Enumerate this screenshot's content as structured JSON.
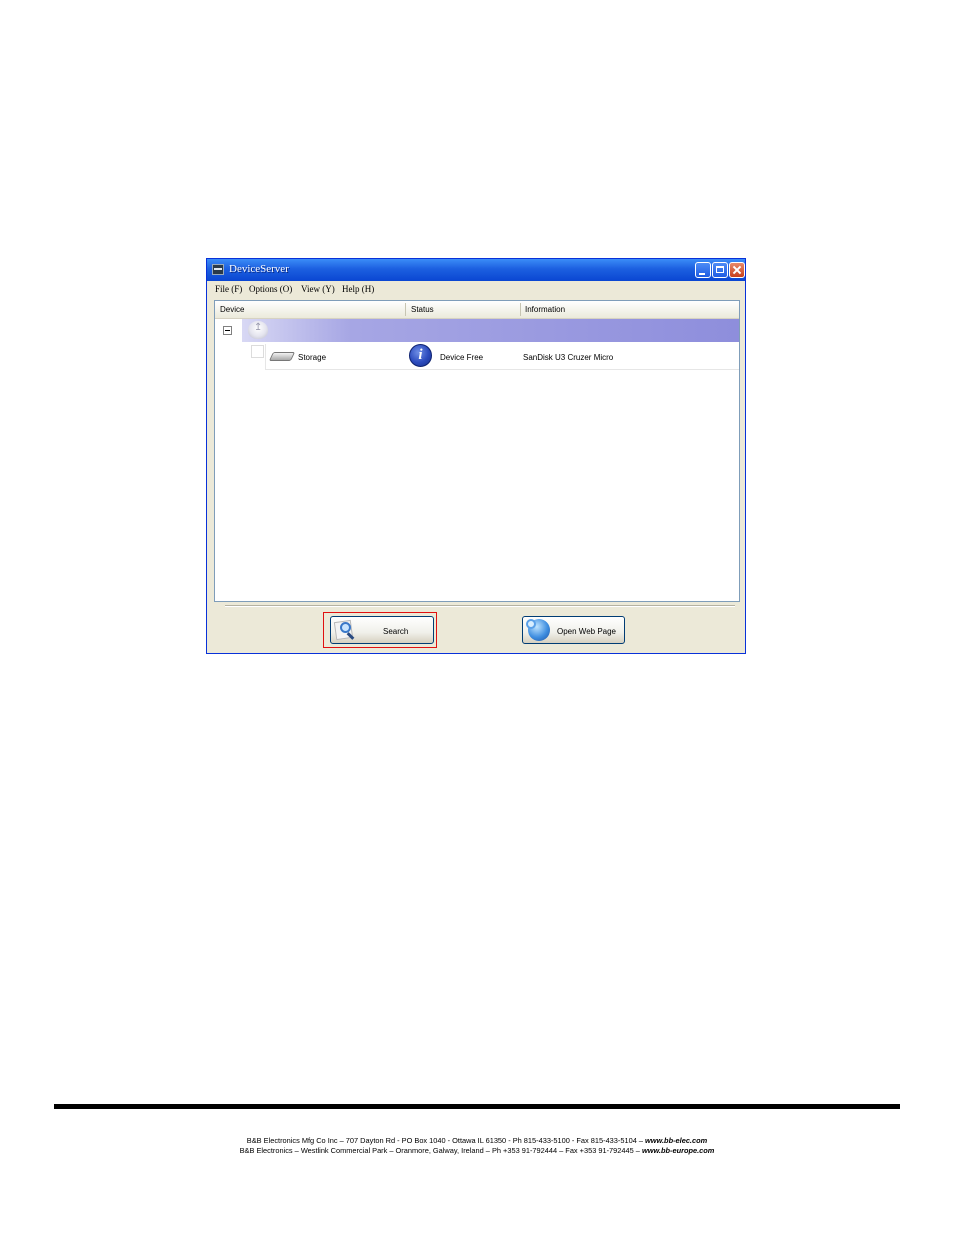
{
  "window": {
    "title": "DeviceServer",
    "menu": [
      "File (F)",
      "Options (O)",
      "View (Y)",
      "Help (H)"
    ]
  },
  "list": {
    "columns": [
      "Device",
      "Status",
      "Information"
    ],
    "rows": [
      {
        "device": "Storage",
        "status": "Device Free",
        "information": "SanDisk U3 Cruzer Micro"
      }
    ]
  },
  "buttons": {
    "search": "Search",
    "open_web_page": "Open Web Page"
  },
  "highlight_color": "#e01010",
  "footer": {
    "line1_text": "B&B Electronics Mfg Co Inc – 707 Dayton Rd - PO Box 1040 - Ottawa IL 61350 - Ph 815-433-5100 - Fax 815-433-5104 –",
    "line1_url": "www.bb-elec.com",
    "line2_text": "B&B Electronics – Westlink Commercial Park – Oranmore, Galway, Ireland – Ph +353 91-792444 – Fax +353 91-792445 –",
    "line2_url": "www.bb-europe.com"
  }
}
